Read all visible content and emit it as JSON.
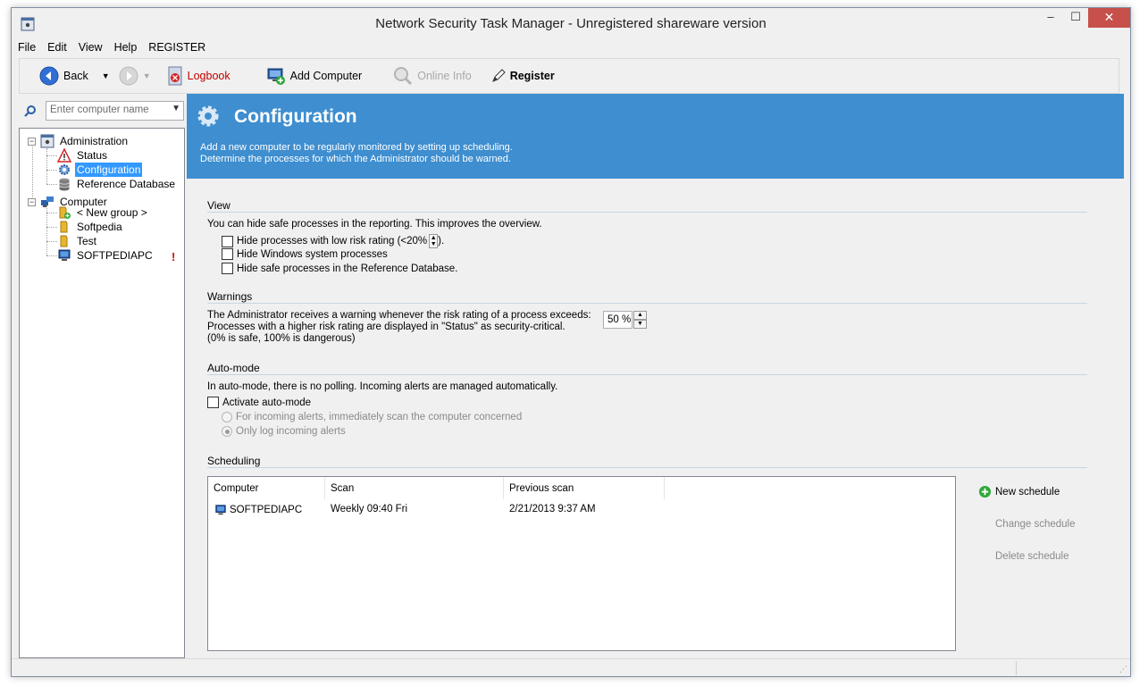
{
  "window": {
    "title": "Network Security Task Manager - Unregistered shareware version",
    "min_label": "–",
    "max_label": "☐",
    "close_label": "✕"
  },
  "menu": [
    "File",
    "Edit",
    "View",
    "Help",
    "REGISTER"
  ],
  "toolbar": {
    "back_label": "Back",
    "logbook_label": "Logbook",
    "add_computer_label": "Add Computer",
    "online_info_label": "Online Info",
    "register_label": "Register"
  },
  "search": {
    "placeholder": "Enter computer name"
  },
  "tree": {
    "administration": "Administration",
    "status": "Status",
    "configuration": "Configuration",
    "reference_db": "Reference Database",
    "computer": "Computer",
    "new_group": "< New group >",
    "softpedia": "Softpedia",
    "test": "Test",
    "softpediapc": "SOFTPEDIAPC",
    "alert_mark": "!"
  },
  "banner": {
    "title": "Configuration",
    "desc_line1": "Add a new computer to be regularly monitored by setting up scheduling.",
    "desc_line2": "Determine the processes for which the Administrator should be warned."
  },
  "view": {
    "heading": "View",
    "intro": "You can hide safe processes in the reporting. This improves the overview.",
    "opt_low_risk": "Hide processes with low risk rating (<20%",
    "opt_low_risk_tail": ").",
    "opt_windows": "Hide Windows system processes",
    "opt_refdb": "Hide safe processes in the Reference Database."
  },
  "warnings": {
    "heading": "Warnings",
    "line1": "The Administrator receives a warning whenever the risk rating of a process exceeds:",
    "line2": "Processes with a higher risk rating are displayed in \"Status\" as security-critical.",
    "line3": "(0% is  safe, 100% is dangerous)",
    "threshold": "50 %"
  },
  "automode": {
    "heading": "Auto-mode",
    "intro": "In auto-mode, there is no polling. Incoming alerts are managed automatically.",
    "activate": "Activate auto-mode",
    "opt_scan": "For incoming alerts, immediately scan the computer concerned",
    "opt_log": "Only log incoming alerts"
  },
  "scheduling": {
    "heading": "Scheduling",
    "columns": [
      "Computer",
      "Scan",
      "Previous scan"
    ],
    "rows": [
      {
        "computer": "SOFTPEDIAPC",
        "scan": "Weekly 09:40 Fri",
        "previous": "2/21/2013  9:37 AM"
      }
    ],
    "new_schedule": "New schedule",
    "change_schedule": "Change schedule",
    "delete_schedule": "Delete schedule"
  },
  "colors": {
    "banner_blue": "#3e8ed0",
    "selection_blue": "#3399ff",
    "close_red": "#c7504a",
    "logbook_red": "#c00000",
    "alert_red": "#e00000"
  }
}
